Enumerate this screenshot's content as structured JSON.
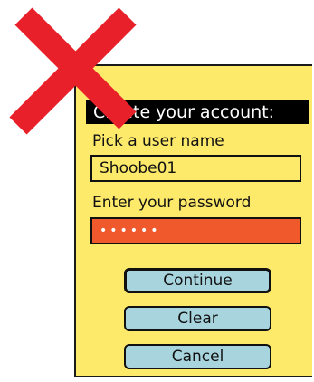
{
  "form": {
    "title": "Create your account:",
    "username_label": "Pick a user name",
    "username_value": "Shoobe01",
    "password_label": "Enter your password",
    "password_value": "••••••"
  },
  "buttons": {
    "continue_label": "Continue",
    "clear_label": "Clear",
    "cancel_label": "Cancel"
  },
  "colors": {
    "panel_bg": "#fde96a",
    "password_bg": "#f0592b",
    "button_bg": "#a8d4de",
    "cross": "#e8202a",
    "title_bg": "#000000"
  },
  "overlay": {
    "icon": "red-x-cross-icon"
  }
}
